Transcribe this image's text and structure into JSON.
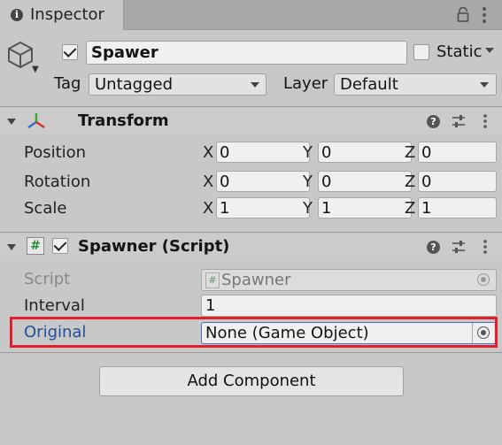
{
  "tab": {
    "title": "Inspector"
  },
  "gameobject": {
    "name": "Spawer",
    "active": true,
    "static_label": "Static",
    "tag_label": "Tag",
    "tag_value": "Untagged",
    "layer_label": "Layer",
    "layer_value": "Default"
  },
  "transform": {
    "title": "Transform",
    "rows": [
      {
        "label": "Position",
        "x": "0",
        "y": "0",
        "z": "0"
      },
      {
        "label": "Rotation",
        "x": "0",
        "y": "0",
        "z": "0"
      },
      {
        "label": "Scale",
        "x": "1",
        "y": "1",
        "z": "1"
      }
    ],
    "axis_labels": {
      "x": "X",
      "y": "Y",
      "z": "Z"
    }
  },
  "spawner": {
    "title": "Spawner (Script)",
    "enabled": true,
    "script_label": "Script",
    "script_value": "Spawner",
    "interval_label": "Interval",
    "interval_value": "1",
    "original_label": "Original",
    "original_value": "None (Game Object)"
  },
  "add_component_label": "Add Component",
  "colors": {
    "highlight": "#e0202a",
    "selected_label": "#1f4fa0",
    "field_focus": "#3a72c4"
  }
}
